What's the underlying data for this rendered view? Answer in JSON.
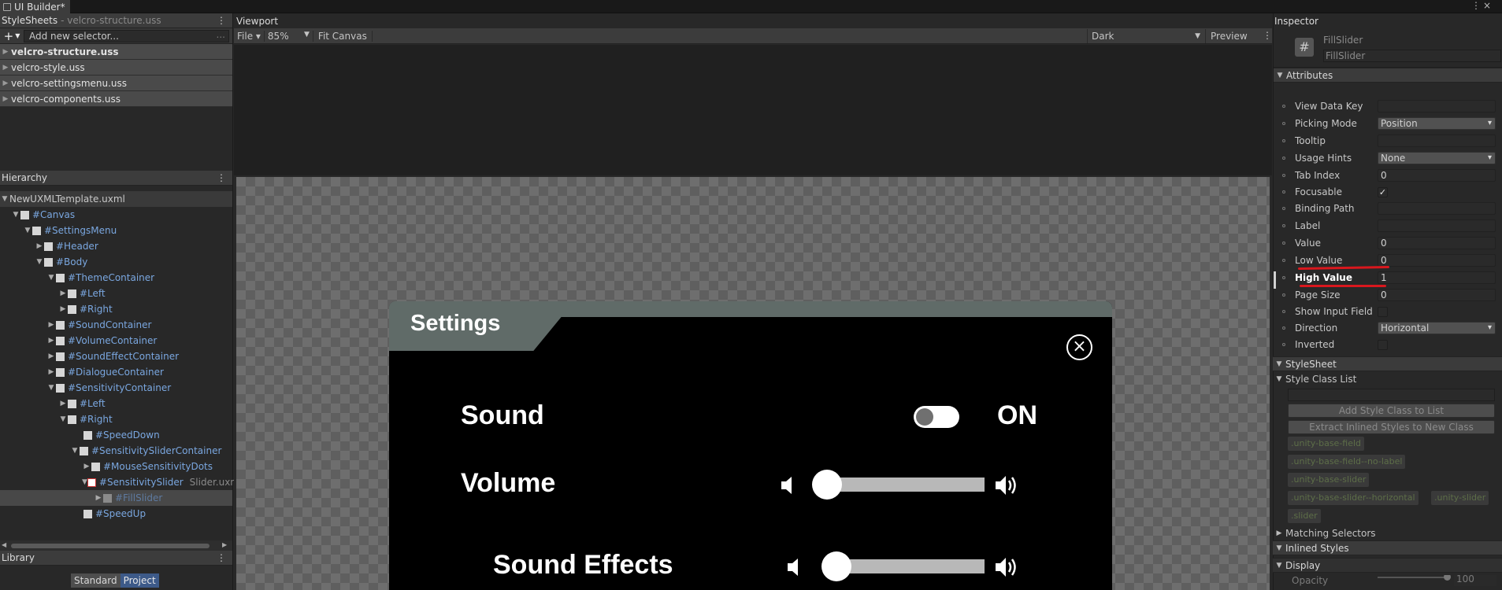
{
  "titlebar": {
    "tab_label": "UI Builder*",
    "kebab": "⋮",
    "close": "×"
  },
  "stylesheets": {
    "title": "StyleSheets",
    "subtitle": "- velcro-structure.uss",
    "add_icon": "+",
    "add_selector_placeholder": "Add new selector...",
    "add_selector_hint": "...",
    "files": [
      "velcro-structure.uss",
      "velcro-style.uss",
      "velcro-settingsmenu.uss",
      "velcro-components.uss"
    ]
  },
  "hierarchy": {
    "title": "Hierarchy",
    "root": "NewUXMLTemplate.uxml",
    "items": [
      {
        "label": "#Canvas",
        "arrow": "▼"
      },
      {
        "label": "#SettingsMenu",
        "arrow": "▼"
      },
      {
        "label": "#Header",
        "arrow": "▶"
      },
      {
        "label": "#Body",
        "arrow": "▼"
      },
      {
        "label": "#ThemeContainer",
        "arrow": "▼"
      },
      {
        "label": "#Left",
        "arrow": "▶"
      },
      {
        "label": "#Right",
        "arrow": "▶"
      },
      {
        "label": "#SoundContainer",
        "arrow": "▶"
      },
      {
        "label": "#VolumeContainer",
        "arrow": "▶"
      },
      {
        "label": "#SoundEffectContainer",
        "arrow": "▶"
      },
      {
        "label": "#DialogueContainer",
        "arrow": "▶"
      },
      {
        "label": "#SensitivityContainer",
        "arrow": "▼"
      },
      {
        "label": "#Left",
        "arrow": "▶"
      },
      {
        "label": "#Right",
        "arrow": "▼"
      },
      {
        "label": "#SpeedDown",
        "arrow": ""
      },
      {
        "label": "#SensitivitySliderContainer",
        "arrow": "▼"
      },
      {
        "label": "#MouseSensitivityDots",
        "arrow": "▶"
      },
      {
        "label": "#SensitivitySlider",
        "arrow": "▼",
        "suffix": "Slider.uxn"
      },
      {
        "label": "#FillSlider",
        "arrow": "▶"
      },
      {
        "label": "#SpeedUp",
        "arrow": ""
      }
    ]
  },
  "library": {
    "title": "Library",
    "tab_standard": "Standard",
    "tab_project": "Project"
  },
  "viewport": {
    "title": "Viewport",
    "file_menu": "File ▾",
    "zoom": "85%",
    "fit_canvas": "Fit Canvas",
    "theme": "Dark",
    "preview": "Preview"
  },
  "settings_menu": {
    "title": "Settings",
    "sound_label": "Sound",
    "sound_state": "ON",
    "sound_toggle_on": true,
    "volume_label": "Volume",
    "volume_level": 0.03,
    "sound_effects_label": "Sound Effects",
    "sound_effects_level": 0.05
  },
  "inspector": {
    "title": "Inspector",
    "element_type": "FillSlider",
    "element_name": "FillSlider",
    "attributes_title": "Attributes",
    "rows": [
      {
        "label": "View Data Key",
        "value": ""
      },
      {
        "label": "Picking Mode",
        "value": "Position"
      },
      {
        "label": "Tooltip",
        "value": ""
      },
      {
        "label": "Usage Hints",
        "value": "None"
      },
      {
        "label": "Tab Index",
        "value": "0"
      },
      {
        "label": "Focusable",
        "value": "✓"
      },
      {
        "label": "Binding Path",
        "value": ""
      },
      {
        "label": "Label",
        "value": ""
      },
      {
        "label": "Value",
        "value": "0"
      },
      {
        "label": "Low Value",
        "value": "0"
      },
      {
        "label": "High Value",
        "value": "1"
      },
      {
        "label": "Page Size",
        "value": "0"
      },
      {
        "label": "Show Input Field",
        "value": ""
      },
      {
        "label": "Direction",
        "value": "Horizontal"
      },
      {
        "label": "Inverted",
        "value": ""
      }
    ],
    "stylesheet_title": "StyleSheet",
    "style_class_list_title": "Style Class List",
    "add_style_class": "Add Style Class to List",
    "extract_inline": "Extract Inlined Styles to New Class",
    "classes": [
      ".unity-base-field",
      ".unity-base-field--no-label",
      ".unity-base-slider",
      ".unity-base-slider--horizontal",
      ".unity-slider",
      ".slider"
    ],
    "matching_selectors": "Matching Selectors",
    "inlined_styles": "Inlined Styles",
    "display": "Display",
    "opacity_label": "Opacity",
    "opacity_value": "100"
  },
  "colors": {
    "accent_red": "#d9171d",
    "hierarchy_link": "#7aa7e0",
    "selection": "#484848"
  }
}
